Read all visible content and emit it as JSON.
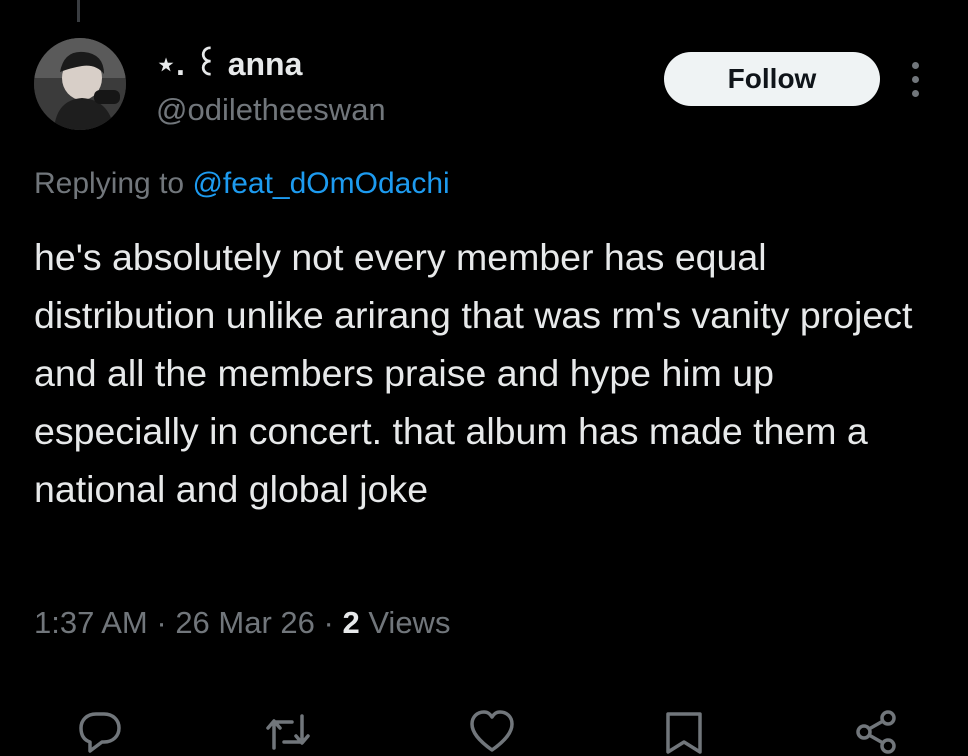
{
  "author": {
    "display_name": "⋆. ꒰ anna",
    "handle": "@odiletheeswan"
  },
  "follow_label": "Follow",
  "reply_context": {
    "prefix": "Replying to ",
    "handle": "@feat_dOmOdachi"
  },
  "tweet": {
    "text": "he's absolutely not every member has equal distribution unlike arirang that was rm's vanity project and all the members praise and hype him up especially in concert. that album has made them a national and global joke"
  },
  "meta": {
    "time": "1:37 AM",
    "sep1": " · ",
    "date": "26 Mar 26",
    "sep2": " · ",
    "views_count": "2",
    "views_label": " Views"
  },
  "actions": [
    "reply-icon",
    "retweet-icon",
    "like-icon",
    "bookmark-icon",
    "share-icon"
  ],
  "colors": {
    "background": "#000000",
    "text_primary": "#e7e9ea",
    "text_secondary": "#71767b",
    "link": "#1d9bf0",
    "follow_bg": "#eff3f4"
  }
}
